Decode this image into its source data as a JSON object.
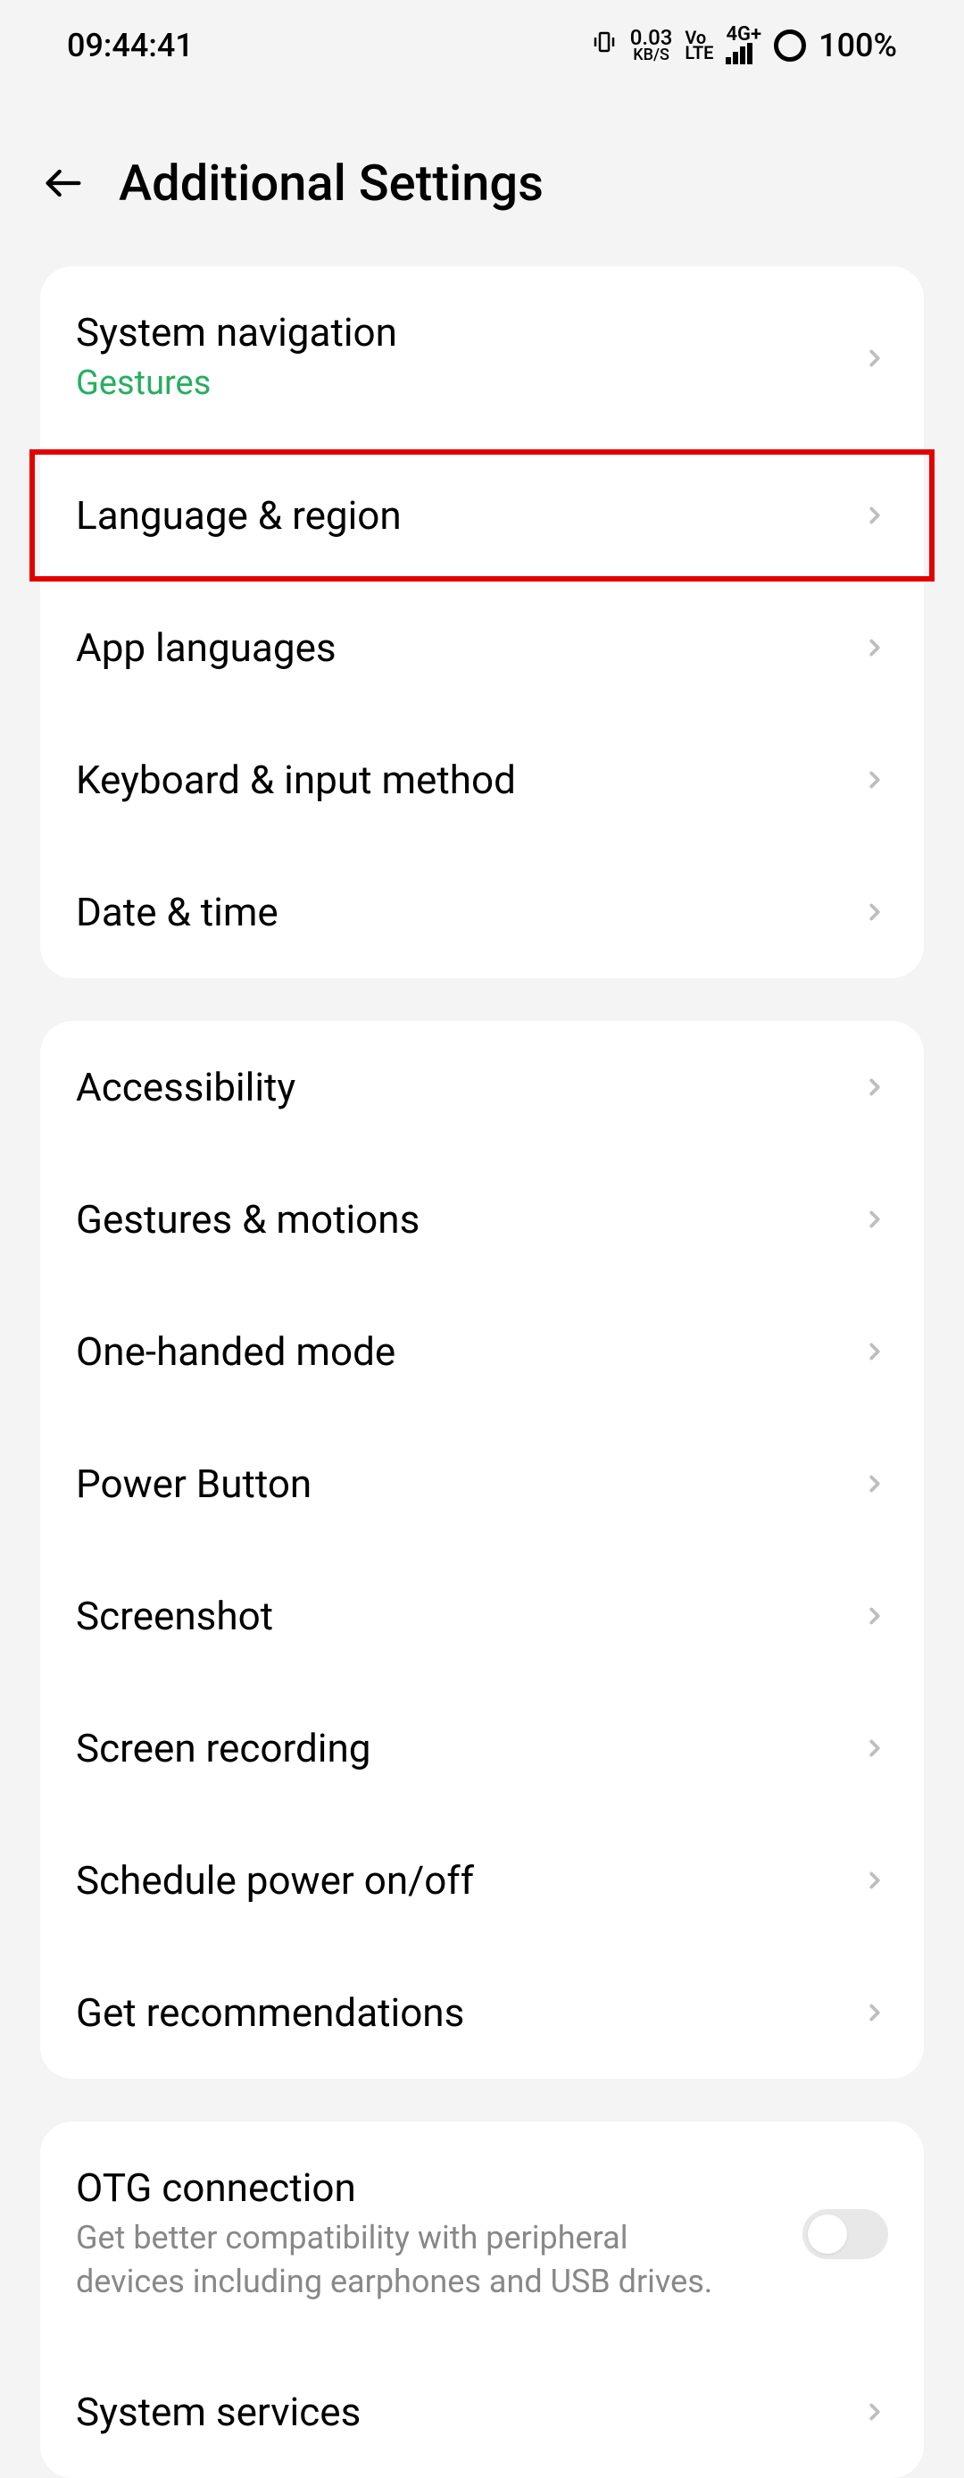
{
  "status": {
    "time": "09:44:41",
    "dataRate": "0.03",
    "dataUnit": "KB/S",
    "volte": "Vo\nLTE",
    "network": "4G+",
    "battery": "100%"
  },
  "header": {
    "title": "Additional Settings"
  },
  "groups": [
    {
      "id": "g1",
      "items": [
        {
          "id": "system-navigation",
          "title": "System navigation",
          "subtitle": "Gestures",
          "subtitleStyle": "green",
          "type": "nav"
        },
        {
          "id": "language-region",
          "title": "Language & region",
          "type": "nav",
          "highlighted": true
        },
        {
          "id": "app-languages",
          "title": "App languages",
          "type": "nav"
        },
        {
          "id": "keyboard-input",
          "title": "Keyboard & input method",
          "type": "nav"
        },
        {
          "id": "date-time",
          "title": "Date & time",
          "type": "nav"
        }
      ]
    },
    {
      "id": "g2",
      "items": [
        {
          "id": "accessibility",
          "title": "Accessibility",
          "type": "nav"
        },
        {
          "id": "gestures-motions",
          "title": "Gestures & motions",
          "type": "nav"
        },
        {
          "id": "one-handed-mode",
          "title": "One-handed mode",
          "type": "nav"
        },
        {
          "id": "power-button",
          "title": "Power Button",
          "type": "nav"
        },
        {
          "id": "screenshot",
          "title": "Screenshot",
          "type": "nav"
        },
        {
          "id": "screen-recording",
          "title": "Screen recording",
          "type": "nav"
        },
        {
          "id": "schedule-power",
          "title": "Schedule power on/off",
          "type": "nav"
        },
        {
          "id": "get-recommendations",
          "title": "Get recommendations",
          "type": "nav"
        }
      ]
    },
    {
      "id": "g3",
      "items": [
        {
          "id": "otg-connection",
          "title": "OTG connection",
          "subtitle": "Get better compatibility with peripheral devices including earphones and USB drives.",
          "type": "toggle",
          "toggled": false
        },
        {
          "id": "system-services",
          "title": "System services",
          "type": "nav"
        }
      ]
    }
  ]
}
